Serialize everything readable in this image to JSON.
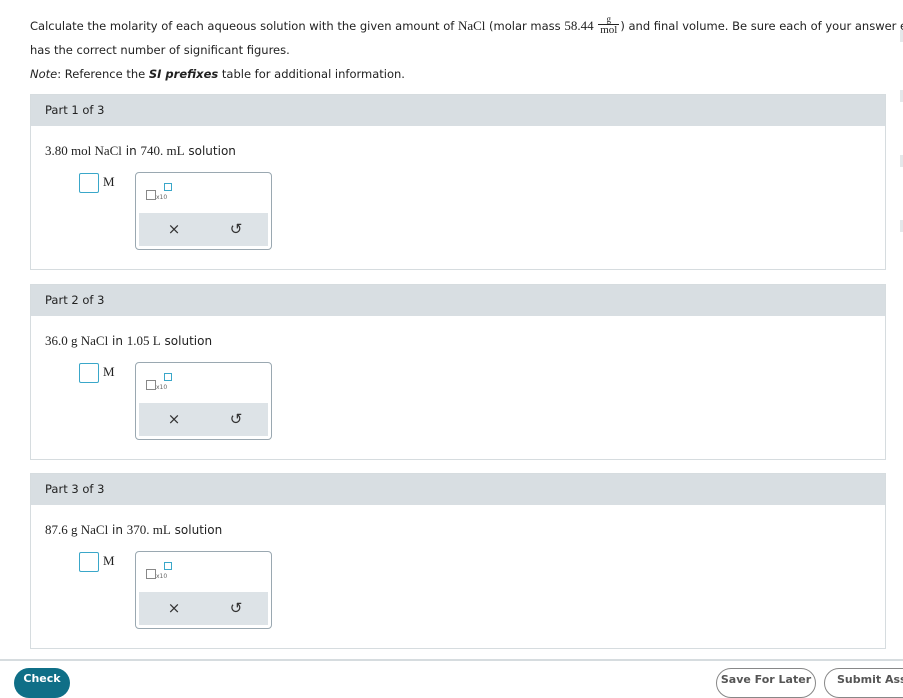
{
  "intro": {
    "line1_pre": "Calculate the molarity of each aqueous solution with the given amount of ",
    "formula": "NaCl",
    "line1_mid": " (molar mass ",
    "molar_mass": "58.44",
    "unit_num": "g",
    "unit_den": "mol",
    "line1_post": ") and final volume. Be sure each of your answer entries",
    "line2": "has the correct number of significant figures.",
    "note_label": "Note",
    "note_mid": ": Reference the ",
    "note_bold": "SI prefixes",
    "note_post": " table for additional information."
  },
  "parts": [
    {
      "header": "Part 1 of 3",
      "q_amount": "3.80 mol NaCl",
      "q_in": " in ",
      "q_volume": "740. mL",
      "q_suffix": " solution",
      "unit": "M"
    },
    {
      "header": "Part 2 of 3",
      "q_amount": "36.0 g NaCl",
      "q_in": " in ",
      "q_volume": "1.05 L",
      "q_suffix": " solution",
      "unit": "M"
    },
    {
      "header": "Part 3 of 3",
      "q_amount": "87.6 g NaCl",
      "q_in": " in ",
      "q_volume": "370. mL",
      "q_suffix": " solution",
      "unit": "M"
    }
  ],
  "toolbar": {
    "exp_label": "x10",
    "clear_glyph": "×",
    "undo_glyph": "↺"
  },
  "footer": {
    "check": "Check",
    "save": "Save For Later",
    "submit": "Submit Assi"
  }
}
